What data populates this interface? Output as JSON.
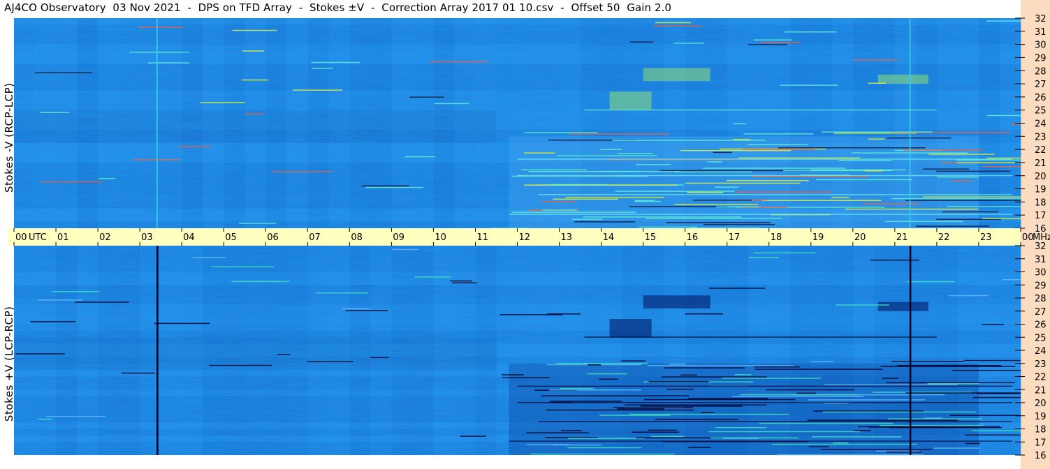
{
  "title": "AJ4CO Observatory  03 Nov 2021  -  DPS on TFD Array  -  Stokes ±V  -  Correction Array 2017 01 10.csv  -  Offset 50  Gain 2.0",
  "colors": {
    "background_blue": "#1a70d8",
    "time_band": "#ffffc0",
    "freq_strip": "#fcdcc0",
    "bright_line": "#3fd0f0",
    "dark_line": "#00002a"
  },
  "chart_data": [
    {
      "type": "heatmap",
      "name": "top",
      "ylabel": "Stokes -V (RCP-LCP)",
      "x_ticks": [
        "00",
        "01",
        "02",
        "03",
        "04",
        "05",
        "06",
        "07",
        "08",
        "09",
        "10",
        "11",
        "12",
        "13",
        "14",
        "15",
        "16",
        "17",
        "18",
        "19",
        "20",
        "21",
        "22",
        "23",
        "00"
      ],
      "x_unit_left": "UTC",
      "y_ticks": [
        "32",
        "31",
        "30",
        "29",
        "28",
        "27",
        "26",
        "25",
        "24",
        "23",
        "22",
        "21",
        "20",
        "19",
        "18",
        "17",
        "16"
      ],
      "y_unit": "MHz",
      "xlim_hours": [
        0,
        24
      ],
      "ylim_mhz": [
        16,
        32
      ],
      "vertical_markers_hours": [
        3.4,
        21.35
      ],
      "marker_color": "#3fd0f0"
    },
    {
      "type": "heatmap",
      "name": "bottom",
      "ylabel": "Stokes +V (LCP-RCP)",
      "x_ticks": [
        "00",
        "01",
        "02",
        "03",
        "04",
        "05",
        "06",
        "07",
        "08",
        "09",
        "10",
        "11",
        "12",
        "13",
        "14",
        "15",
        "16",
        "17",
        "18",
        "19",
        "20",
        "21",
        "22",
        "23",
        "00"
      ],
      "y_ticks": [
        "32",
        "31",
        "30",
        "29",
        "28",
        "27",
        "26",
        "25",
        "24",
        "23",
        "22",
        "21",
        "20",
        "19",
        "18",
        "17",
        "16"
      ],
      "y_unit": "MHz",
      "xlim_hours": [
        0,
        24
      ],
      "ylim_mhz": [
        16,
        32
      ],
      "vertical_markers_hours": [
        3.4,
        21.35
      ],
      "marker_color": "#000020"
    }
  ]
}
